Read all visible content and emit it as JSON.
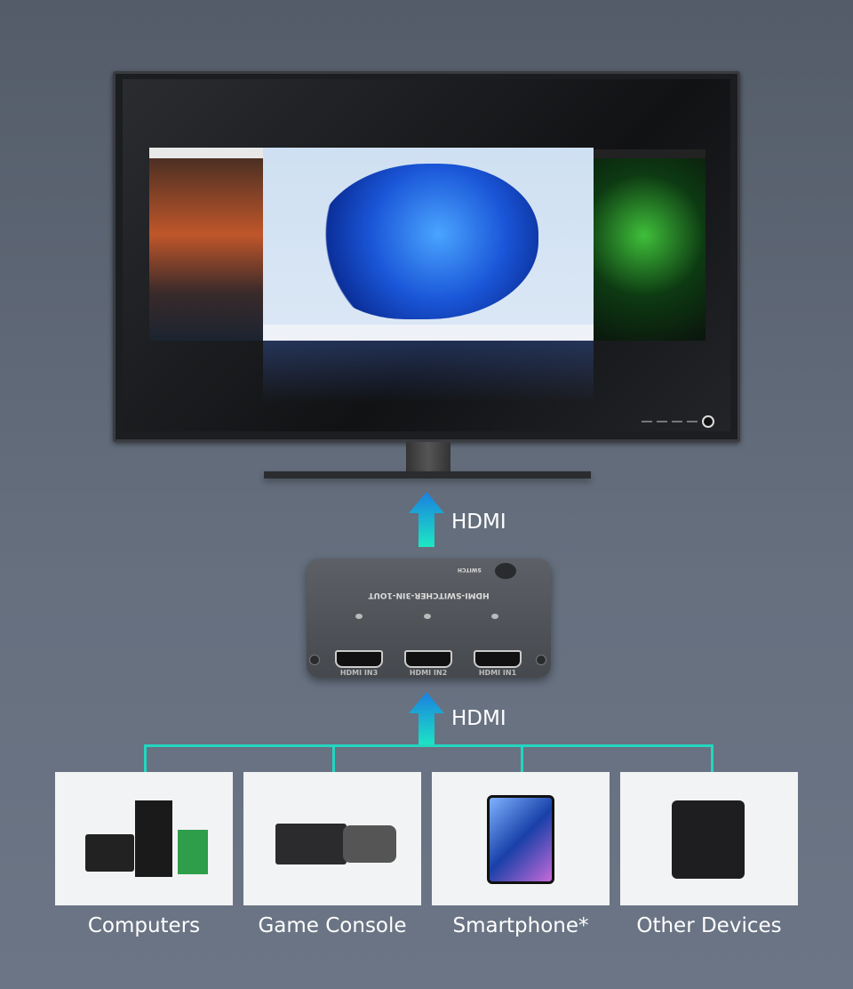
{
  "diagram": {
    "arrow_label_top": "HDMI",
    "arrow_label_bottom": "HDMI",
    "switch": {
      "model": "HDMI-SWITCHER-3IN-1OUT",
      "button_label": "SWITCH",
      "ports": [
        "HDMI IN3",
        "HDMI IN2",
        "HDMI IN1"
      ]
    },
    "devices": [
      {
        "label": "Computers"
      },
      {
        "label": "Game Console"
      },
      {
        "label": "Smartphone*"
      },
      {
        "label": "Other Devices"
      }
    ],
    "colors": {
      "arrow_top": "#1a7fe0",
      "arrow_bottom": "#1de8c4",
      "connector_line": "#22d6c0",
      "background": "#5f6876"
    }
  }
}
